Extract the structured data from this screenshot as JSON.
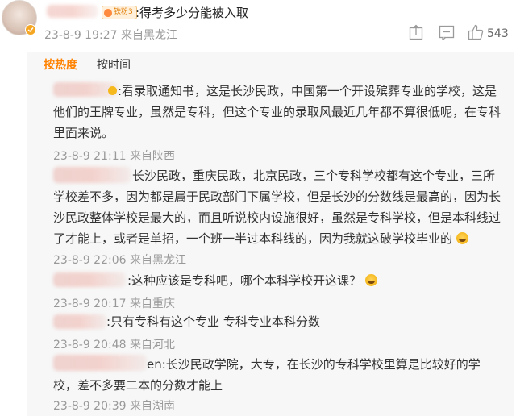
{
  "main_comment": {
    "badge": "铁粉3",
    "text": ":得考多少分能被入取",
    "meta": "23-8-9 19:27 来自黑龙江",
    "likes": "543"
  },
  "sort_tabs": {
    "hot": "按热度",
    "time": "按时间"
  },
  "replies": [
    {
      "lines": [
        ":看录取通知书，这是长沙民政，中国第一个开设殡葬专业的学校，这是",
        "他们的王牌专业，虽然是专科，但这个专业的录取风最近几年都不算很低呢，在专科",
        "里面来说。"
      ],
      "meta": "23-8-9 21:11 来自陕西"
    },
    {
      "lines": [
        "长沙民政，重庆民政，北京民政，三个专科学校都有这个专业，三所",
        "学校差不多，因为都是属于民政部门下属学校，但是长沙的分数线是最高的，因为长",
        "沙民政整体学校是最大的，而且听说校内设施很好，虽然是专科学校，但是本科线过",
        "了才能上，或者是单招，一个班一半过本科线的，因为我就这破学校毕业的"
      ],
      "meta": "23-8-9 22:06 来自黑龙江"
    },
    {
      "lines": [
        ":这种应该是专科吧，哪个本科学校开这课？"
      ],
      "meta": "23-8-9 20:17 来自重庆"
    },
    {
      "lines": [
        ":只有专科有这个专业 专科专业本科分数"
      ],
      "meta": "23-8-9 20:48 来自河北"
    },
    {
      "lines": [
        "en:长沙民政学院，大专，在长沙的专科学校里算是比较好的学",
        "校，差不多要二本的分数才能上"
      ],
      "meta": "23-8-9 20:39 来自湖南"
    }
  ],
  "icons": [
    "share-icon",
    "comment-icon",
    "like-icon",
    "laugh-emoji-icon",
    "verified-badge-icon"
  ],
  "colors": {
    "accent": "#ff8200",
    "meta_gray": "#999999",
    "reply_background": "#f7f7f7"
  }
}
